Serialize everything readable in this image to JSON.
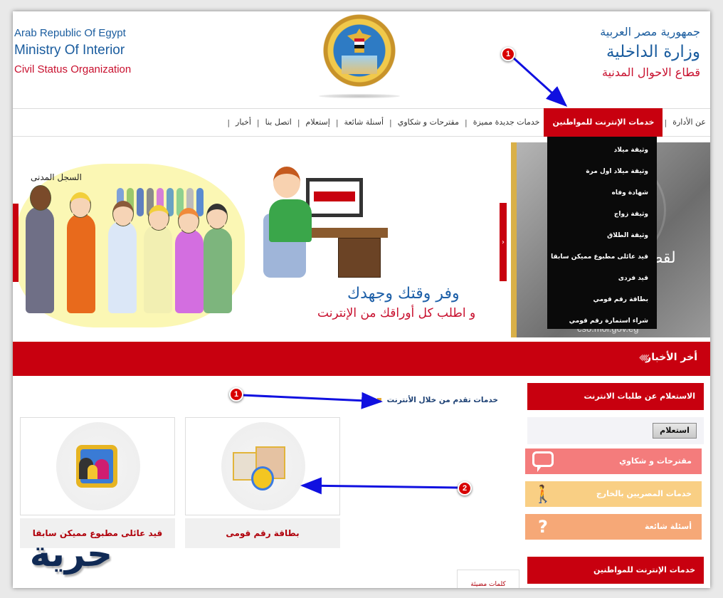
{
  "header": {
    "en_line1": "Arab Republic Of Egypt",
    "en_line2": "Ministry Of Interior",
    "en_line3": "Civil Status Organization",
    "ar_line1": "جمهورية مصر العربية",
    "ar_line2": "وزارة الداخلية",
    "ar_line3": "قطاع الاحوال المدنية"
  },
  "nav": {
    "items": [
      {
        "label": "عن الأدارة"
      },
      {
        "label": "خدمات الإنترنت للمواطنين",
        "active": true
      },
      {
        "label": "خدمات جديدة مميزة"
      },
      {
        "label": "مقترحات و شكاوي"
      },
      {
        "label": "أسنلة شائعة"
      },
      {
        "label": "إستعلام"
      },
      {
        "label": "اتصل بنا"
      },
      {
        "label": "أخبار"
      }
    ],
    "separator": "|"
  },
  "dropdown": {
    "items": [
      "وثيقة ميلاد",
      "وثيقة ميلاد اول مرة",
      "شهادة وفاه",
      "وثيقة زواج",
      "وثيقة الطلاق",
      "قيد عائلى مطبوع مميكن سابقا",
      "قيد فردى",
      "بطاقة رقم قومي",
      "شراء استمارة رقم قومي"
    ]
  },
  "banner": {
    "people_label": "السجل المدنى",
    "slogan_line1": "وفر وقتك وجهدك",
    "slogan_line2": "و اطلب كل أوراقك من الإنترنت",
    "side_text": "لقط",
    "side_url": "cso.moi.gov.eg",
    "next_arrow": "›"
  },
  "news": {
    "title": "أخر الأخبار",
    "chevrons": "‹‹‹‹"
  },
  "content": {
    "services_heading": "خدمات تقدم من خلال الأنترنت",
    "cards": [
      {
        "caption": "قيد عائلى مطبوع مميكن سابقا",
        "icon": "family-icon"
      },
      {
        "caption": "بطاقة رقم قومى",
        "icon": "id-card-icon"
      }
    ],
    "bookmark_tab": "كلمات مضيئة"
  },
  "sidebar": {
    "inquiry_heading": "الاستعلام عن طلبات الانترنت",
    "inquiry_button": "استعلام",
    "tiles": [
      {
        "label": "مقترحات و شكاوي",
        "icon": "speech-bubble-icon",
        "color": "#f47c7c"
      },
      {
        "label": "خدمات المصريين بالخارج",
        "icon": "traveler-icon",
        "color": "#f9cf84"
      },
      {
        "label": "أسئلة شائعة",
        "icon": "question-mark-icon",
        "color": "#f6a877"
      }
    ],
    "citizens_heading": "خدمات الإنترنت للمواطنين"
  },
  "watermark": {
    "text": "حرية"
  },
  "annotations": [
    {
      "label": "1"
    },
    {
      "label": "1"
    },
    {
      "label": "2"
    }
  ],
  "colors": {
    "brand_red": "#c8000f",
    "brand_blue": "#1a5c9e",
    "accent_gold": "#d9b048",
    "annotation_arrow": "#1010e0"
  }
}
